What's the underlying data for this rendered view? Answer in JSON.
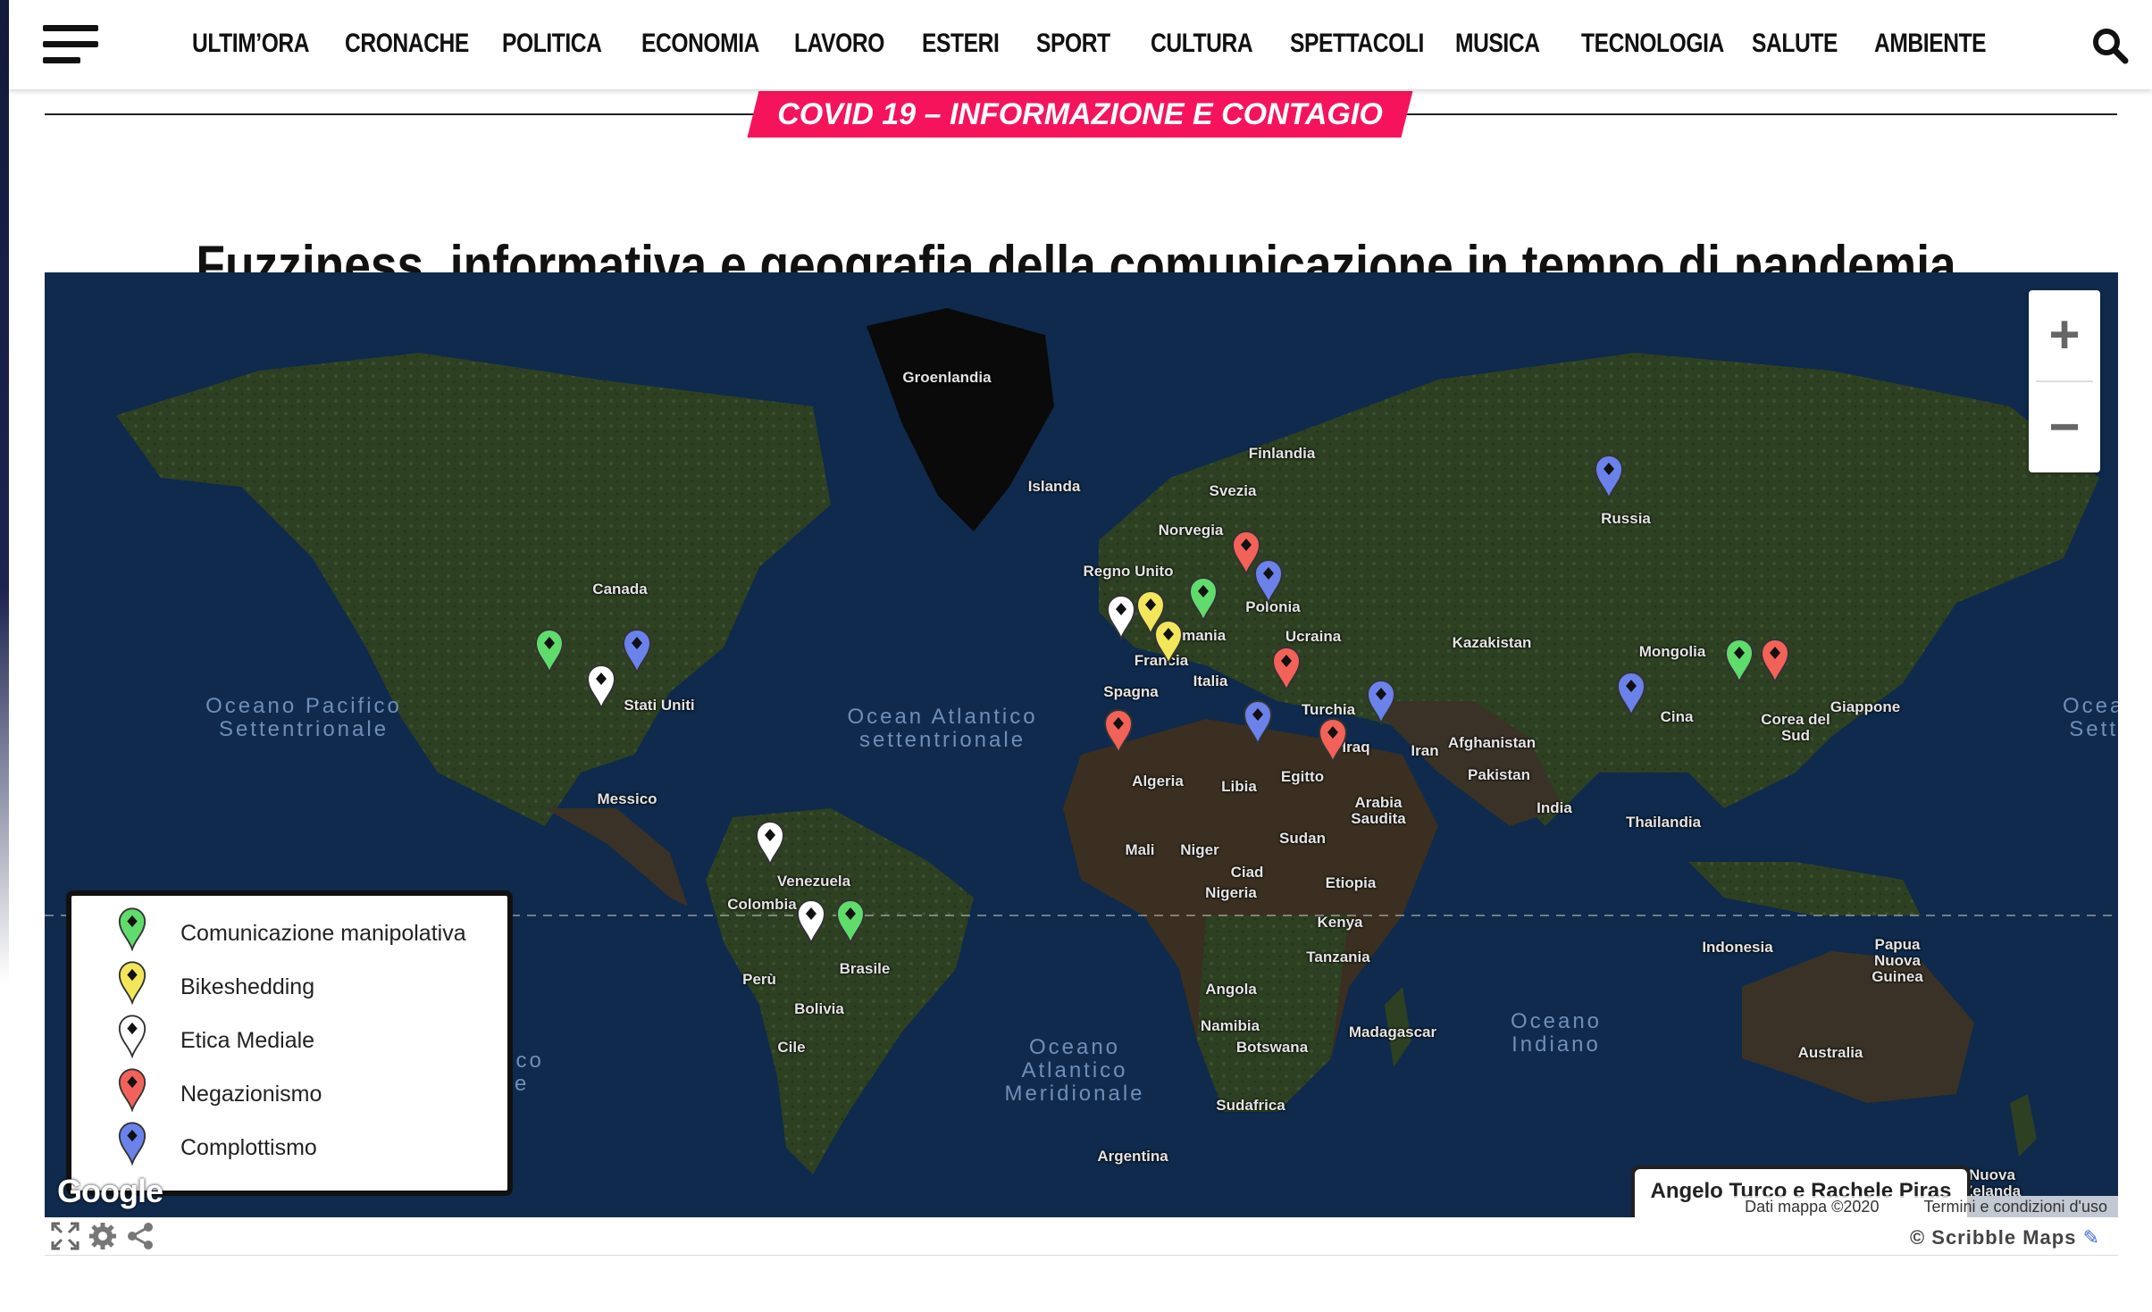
{
  "header": {
    "menu_icon": "hamburger-menu-icon",
    "nav": [
      {
        "id": "ultimora",
        "label": "ULTIM’ORA"
      },
      {
        "id": "cronache",
        "label": "CRONACHE"
      },
      {
        "id": "politica",
        "label": "POLITICA"
      },
      {
        "id": "economia",
        "label": "ECONOMIA"
      },
      {
        "id": "lavoro",
        "label": "LAVORO"
      },
      {
        "id": "esteri",
        "label": "ESTERI"
      },
      {
        "id": "sport",
        "label": "SPORT"
      },
      {
        "id": "cultura",
        "label": "CULTURA"
      },
      {
        "id": "spettacoli",
        "label": "SPETTACOLI"
      },
      {
        "id": "musica",
        "label": "MUSICA"
      },
      {
        "id": "tecnologia",
        "label": "TECNOLOGIA"
      },
      {
        "id": "salute",
        "label": "SALUTE"
      },
      {
        "id": "ambiente",
        "label": "AMBIENTE"
      }
    ],
    "search_icon": "search-icon"
  },
  "category_badge": "COVID 19 – INFORMAZIONE E CONTAGIO",
  "article_title": "Fuzziness, informativa e geografia della comunicazione in tempo di pandemia",
  "map": {
    "country_labels": [
      "Groenlandia",
      "Islanda",
      "Finlandia",
      "Svezia",
      "Norvegia",
      "Regno Unito",
      "Polonia",
      "Germania",
      "Francia",
      "Italia",
      "Ucraina",
      "Spagna",
      "Turchia",
      "Kazakistan",
      "Russia",
      "Mongolia",
      "Cina",
      "Corea del Sud",
      "Giappone",
      "Canada",
      "Stati Uniti",
      "Messico",
      "Venezuela",
      "Colombia",
      "Brasile",
      "Perù",
      "Bolivia",
      "Cile",
      "Argentina",
      "Algeria",
      "Libia",
      "Egitto",
      "Iraq",
      "Iran",
      "Arabia Saudita",
      "Afghanistan",
      "Pakistan",
      "India",
      "Thailandia",
      "Indonesia",
      "Papua Nuova Guinea",
      "Australia",
      "Nuova Zelanda",
      "Mali",
      "Niger",
      "Ciad",
      "Sudan",
      "Nigeria",
      "Etiopia",
      "Kenya",
      "Tanzania",
      "Angola",
      "Namibia",
      "Botswana",
      "Sudafrica",
      "Madagascar"
    ],
    "ocean_labels": [
      "Oceano Pacifico\nSettentrionale",
      "Ocean Atlantico\nsettentrionale",
      "Oceano\nAtlantico\nMeridionale",
      "Oceano\nIndiano",
      "Oceano\nSetten",
      "ifico\nle"
    ],
    "legend": [
      {
        "label": "Comunicazione manipolativa",
        "color": "#5fdc6c"
      },
      {
        "label": "Bikeshedding",
        "color": "#f2e65a"
      },
      {
        "label": "Etica Mediale",
        "color": "#ffffff"
      },
      {
        "label": "Negazionismo",
        "color": "#f26258"
      },
      {
        "label": "Complottismo",
        "color": "#6a82ea"
      }
    ],
    "zoom_in": "+",
    "zoom_out": "−",
    "google_logo": "Google",
    "author": "Angelo Turco e Rachele Piras",
    "attribution": {
      "data": "Dati mappa ©2020",
      "terms": "Termini e condizioni d'uso"
    },
    "scribble_credit": "© Scribble Maps",
    "tool_icons": [
      "fullscreen-icon",
      "settings-gear-icon",
      "share-icon"
    ]
  }
}
